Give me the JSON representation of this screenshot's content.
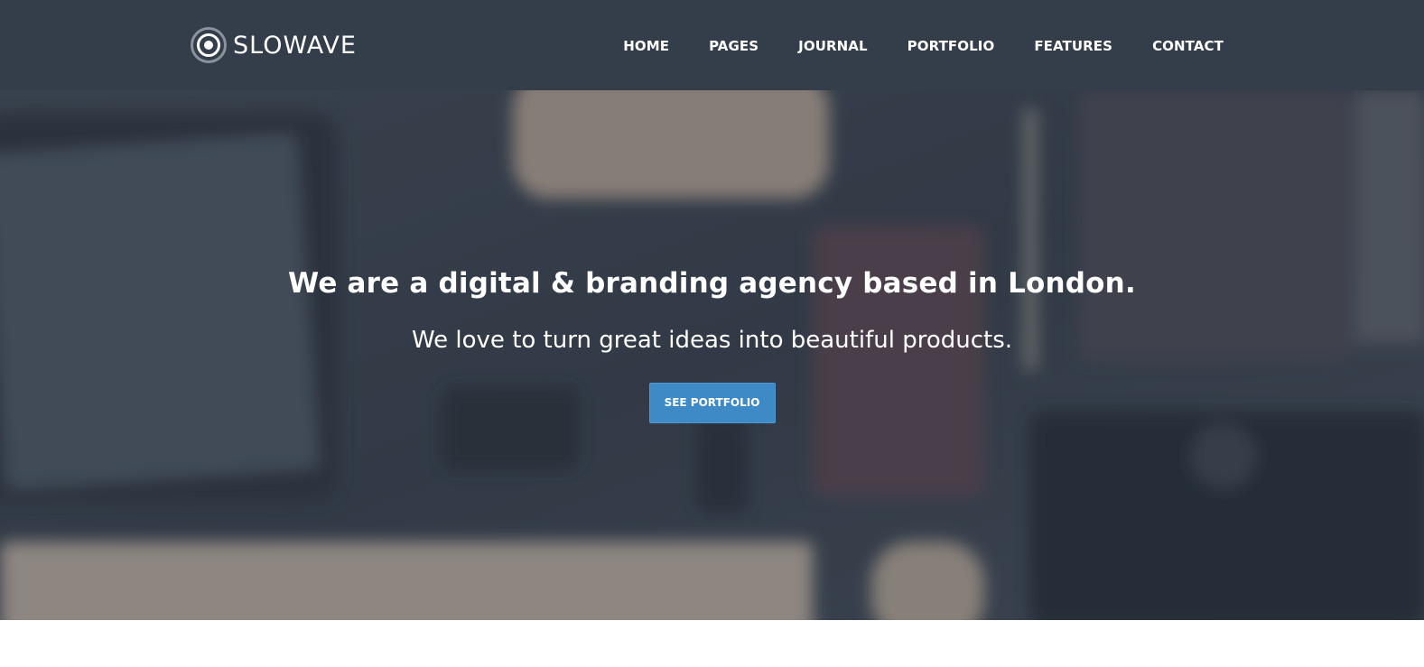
{
  "header": {
    "logo_text": "SLOWAVE",
    "logo_icon": "concentric-circles-icon",
    "background_color": "#343e4b"
  },
  "nav": {
    "items": [
      {
        "label": "HOME"
      },
      {
        "label": "PAGES"
      },
      {
        "label": "JOURNAL"
      },
      {
        "label": "PORTFOLIO"
      },
      {
        "label": "FEATURES"
      },
      {
        "label": "CONTACT"
      }
    ]
  },
  "hero": {
    "title": "We are a digital & branding agency based in London.",
    "subtitle": "We love to turn great ideas into beautiful products.",
    "button_label": "SEE PORTFOLIO",
    "button_color": "#3e8ac7"
  }
}
